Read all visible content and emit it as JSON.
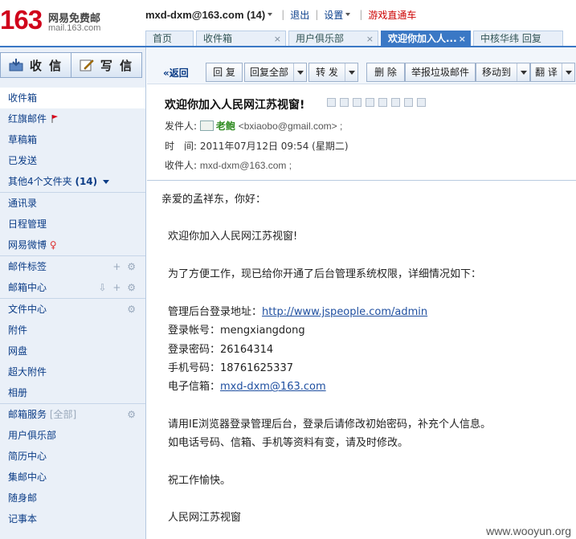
{
  "logo": {
    "number": "163",
    "title": "网易免费邮",
    "domain": "mail.163.com"
  },
  "topbar": {
    "user": "mxd-dxm@163.com",
    "count": "(14)",
    "logout": "退出",
    "settings": "设置",
    "game": "游戏直通车"
  },
  "tabs": [
    {
      "label": "首页"
    },
    {
      "label": "收件箱"
    },
    {
      "label": "用户俱乐部"
    },
    {
      "label": "欢迎你加入人..."
    },
    {
      "label": "中核华纬 回复"
    }
  ],
  "sidebar": {
    "receive": "收 信",
    "compose": "写 信",
    "inbox": "收件箱",
    "flagged": "红旗邮件",
    "drafts": "草稿箱",
    "sent": "已发送",
    "other_folders": "其他4个文件夹",
    "other_count": "(14)",
    "contacts": "通讯录",
    "calendar": "日程管理",
    "weibo": "网易微博",
    "tags": "邮件标签",
    "mail_center": "邮箱中心",
    "file_center": "文件中心",
    "attachments": "附件",
    "netdisk": "网盘",
    "big_attach": "超大附件",
    "album": "相册",
    "services": "邮箱服务",
    "services_all": "[全部]",
    "club": "用户俱乐部",
    "resume": "简历中心",
    "stamps": "集邮中心",
    "portable": "随身邮",
    "more": "记事本"
  },
  "toolbar": {
    "back": "«返回",
    "reply": "回 复",
    "reply_all": "回复全部",
    "forward": "转 发",
    "delete": "删 除",
    "spam": "举报垃圾邮件",
    "move": "移动到",
    "translate": "翻 译"
  },
  "mail": {
    "subject": "欢迎你加入人民网江苏视窗!",
    "from_label": "发件人:",
    "from_name": "老鲍",
    "from_addr": "<bxiaobo@gmail.com> ;",
    "time_label": "时　间:",
    "time_value": "2011年07月12日 09:54 (星期二)",
    "to_label": "收件人:",
    "to_value": "mxd-dxm@163.com ;"
  },
  "body": {
    "greeting": "亲爱的孟祥东，你好：",
    "welcome": "欢迎你加入人民网江苏视窗!",
    "intro": "为了方便工作，现已给你开通了后台管理系统权限，详细情况如下：",
    "admin_label": "管理后台登录地址：",
    "admin_url": "http://www.jspeople.com/admin",
    "account_label": "登录帐号：",
    "account": "mengxiangdong",
    "password_label": "登录密码：",
    "password": "26164314",
    "phone_label": "手机号码：",
    "phone": "18761625337",
    "email_label": "电子信箱：",
    "email": "mxd-dxm@163.com",
    "note1": "请用IE浏览器登录管理后台，登录后请修改初始密码，补充个人信息。",
    "note2": "如电话号码、信箱、手机等资料有变，请及时修改。",
    "wish": "祝工作愉快。",
    "sign": "人民网江苏视窗"
  },
  "watermark": "www.wooyun.org"
}
